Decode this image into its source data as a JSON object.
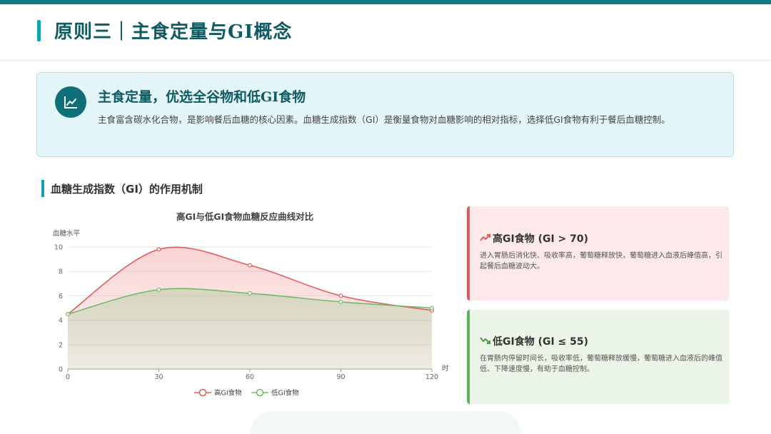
{
  "header": {
    "title": "原则三｜主食定量与GI概念"
  },
  "summary": {
    "icon": "trend-chart-icon",
    "heading": "主食定量，优选全谷物和低GI食物",
    "body": "主食富含碳水化合物，是影响餐后血糖的核心因素。血糖生成指数（GI）是衡量食物对血糖影响的相对指标，选择低GI食物有利于餐后血糖控制。"
  },
  "section": {
    "title": "血糖生成指数（GI）的作用机制"
  },
  "chart_data": {
    "type": "area",
    "title": "高GI与低GI食物血糖反应曲线对比",
    "ylabel": "血糖水平",
    "xlabel": "时",
    "x": [
      0,
      30,
      60,
      90,
      120
    ],
    "xlim": [
      0,
      120
    ],
    "ylim": [
      0,
      10
    ],
    "yticks": [
      0,
      2,
      4,
      6,
      8,
      10
    ],
    "grid": true,
    "legend_position": "bottom",
    "series": [
      {
        "name": "高GI食物",
        "color": "#e06060",
        "values": [
          4.5,
          9.8,
          8.5,
          6.0,
          4.8
        ]
      },
      {
        "name": "低GI食物",
        "color": "#72bb6a",
        "values": [
          4.5,
          6.5,
          6.2,
          5.5,
          5.0
        ]
      }
    ]
  },
  "cards": {
    "high": {
      "icon": "trend-up-icon",
      "title": "高GI食物 (GI > 70)",
      "body": "进入胃肠后消化快、吸收率高，葡萄糖释放快，葡萄糖进入血液后峰值高，引起餐后血糖波动大。",
      "color": "#e05a5a"
    },
    "low": {
      "icon": "trend-down-icon",
      "title": "低GI食物 (GI ≤ 55)",
      "body": "在胃肠内停留时间长，吸收率低，葡萄糖释放缓慢，葡萄糖进入血液后的峰值低、下降速度慢，有助于血糖控制。",
      "color": "#5fb45b"
    }
  }
}
